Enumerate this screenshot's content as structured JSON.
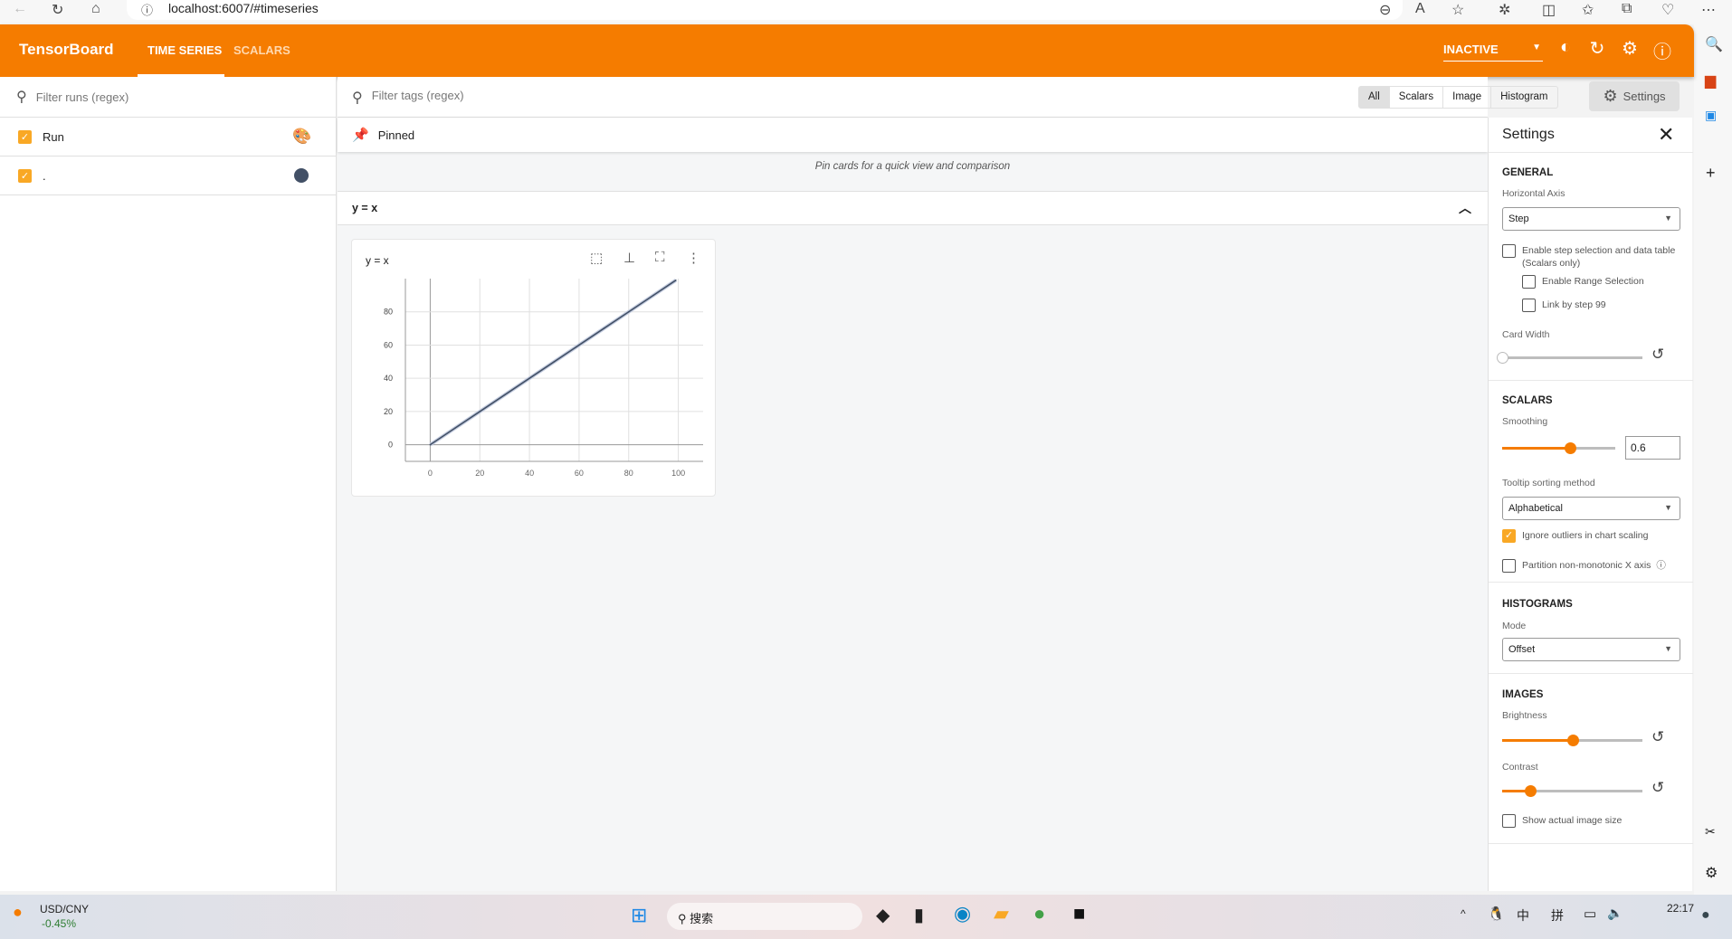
{
  "browser": {
    "url": "localhost:6007/#timeseries"
  },
  "header": {
    "brand": "TensorBoard",
    "tabs": [
      "TIME SERIES",
      "SCALARS"
    ],
    "active_tab": "TIME SERIES",
    "reload_status": "INACTIVE",
    "accent": "#f57c00"
  },
  "runs": {
    "filter_placeholder": "Filter runs (regex)",
    "items": [
      {
        "label": "Run",
        "checked": true
      },
      {
        "label": ".",
        "checked": true,
        "color": "#425066"
      }
    ]
  },
  "main": {
    "filter_placeholder": "Filter tags (regex)",
    "type_tabs": [
      "All",
      "Scalars",
      "Image",
      "Histogram"
    ],
    "selected_type": "All",
    "settings_button": "Settings",
    "pinned_label": "Pinned",
    "pinned_message": "Pin cards for a quick view and comparison",
    "group_title": "y = x"
  },
  "card": {
    "title": "y = x"
  },
  "chart_data": {
    "type": "line",
    "title": "y = x",
    "x": [
      0,
      10,
      20,
      30,
      40,
      50,
      60,
      70,
      80,
      90,
      99
    ],
    "series": [
      {
        "values": [
          0,
          10,
          20,
          30,
          40,
          50,
          60,
          70,
          80,
          90,
          99
        ],
        "color": "#425066"
      }
    ],
    "xticks": [
      "0",
      "20",
      "40",
      "60",
      "80",
      "100"
    ],
    "yticks": [
      "0",
      "20",
      "40",
      "60",
      "80"
    ],
    "xlim": [
      -10,
      110
    ],
    "ylim": [
      -10,
      100
    ],
    "grid": true
  },
  "settings": {
    "title": "Settings",
    "general": {
      "heading": "GENERAL",
      "horizontal_axis_label": "Horizontal Axis",
      "horizontal_axis": "Step",
      "step_selection": "Enable step selection and data table",
      "step_selection_note": "(Scalars only)",
      "range_selection": "Enable Range Selection",
      "link_by_step": "Link by step 99",
      "card_width_label": "Card Width",
      "card_width": 0
    },
    "scalars": {
      "heading": "SCALARS",
      "smoothing_label": "Smoothing",
      "smoothing": "0.6",
      "tooltip_label": "Tooltip sorting method",
      "tooltip": "Alphabetical",
      "ignore_outliers": "Ignore outliers in chart scaling",
      "ignore_outliers_checked": true,
      "partition": "Partition non-monotonic X axis"
    },
    "histograms": {
      "heading": "HISTOGRAMS",
      "mode_label": "Mode",
      "mode": "Offset"
    },
    "images": {
      "heading": "IMAGES",
      "brightness_label": "Brightness",
      "brightness": 0.5,
      "contrast_label": "Contrast",
      "contrast": 0.2,
      "actual_size": "Show actual image size"
    }
  },
  "taskbar": {
    "ticker": "USD/CNY",
    "change": "-0.45%",
    "search": "搜索",
    "time": "22:17",
    "ime1": "中",
    "ime2": "拼"
  }
}
